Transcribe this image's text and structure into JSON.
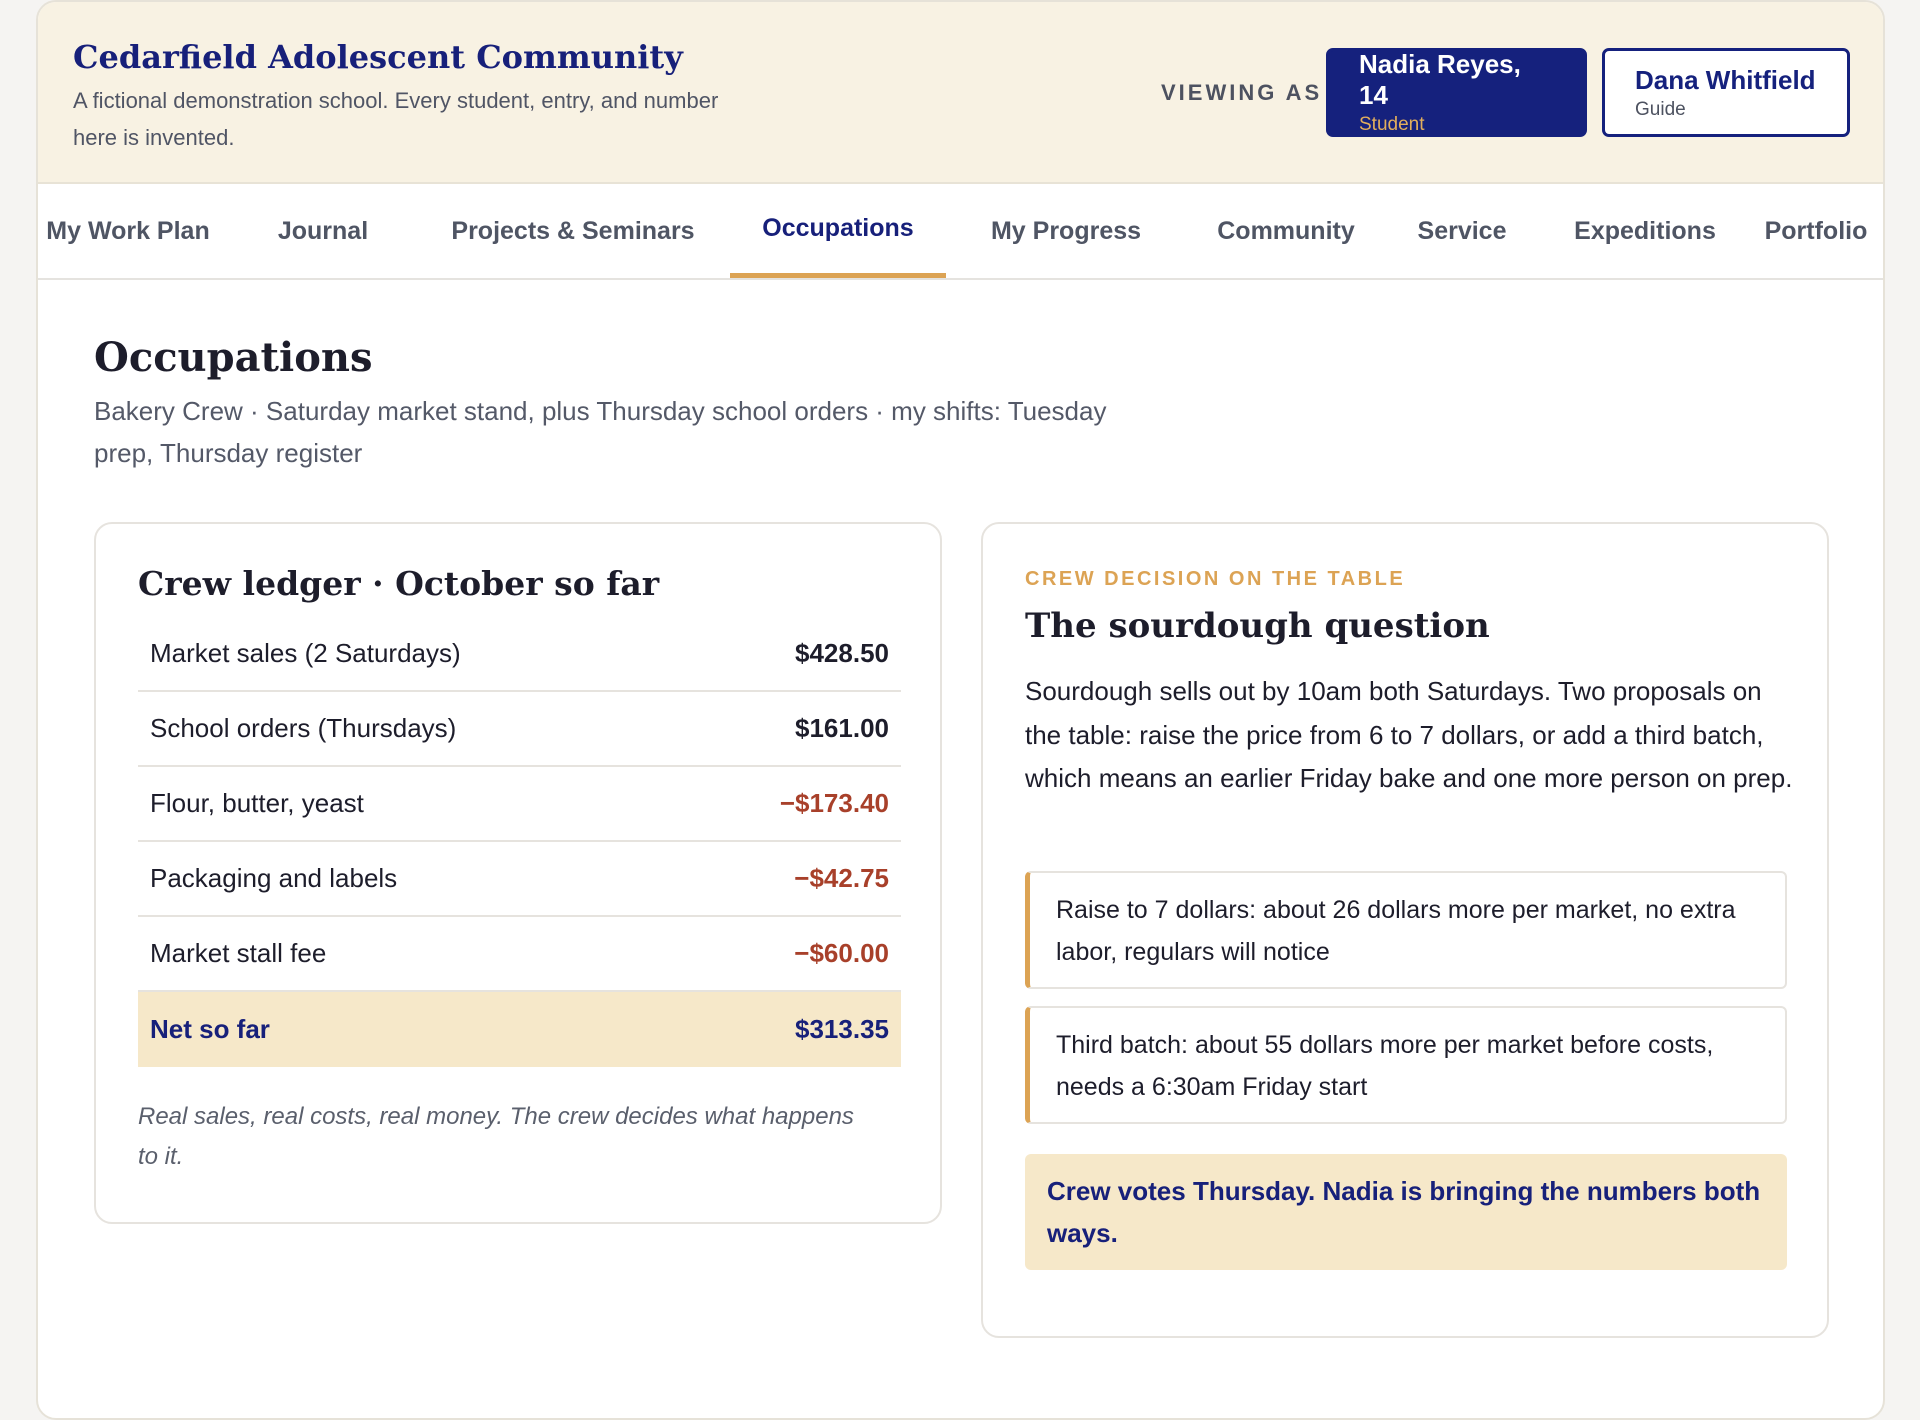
{
  "header": {
    "school_name": "Cedarfield Adolescent Community",
    "school_note": "A fictional demonstration school. Every student, entry, and number here is invented.",
    "viewing_as_label": "VIEWING AS",
    "users": [
      {
        "name": "Nadia Reyes, 14",
        "role": "Student",
        "active": true
      },
      {
        "name": "Dana Whitfield",
        "role": "Guide",
        "active": false
      }
    ]
  },
  "nav": {
    "tabs": [
      {
        "label": "My Work Plan"
      },
      {
        "label": "Journal"
      },
      {
        "label": "Projects & Seminars"
      },
      {
        "label": "Occupations",
        "active": true
      },
      {
        "label": "My Progress"
      },
      {
        "label": "Community"
      },
      {
        "label": "Service"
      },
      {
        "label": "Expeditions"
      },
      {
        "label": "Portfolio"
      }
    ]
  },
  "page": {
    "title": "Occupations",
    "subtitle": "Bakery Crew · Saturday market stand, plus Thursday school orders · my shifts: Tuesday prep, Thursday register"
  },
  "ledger": {
    "title": "Crew ledger · October so far",
    "rows": [
      {
        "label": "Market sales (2 Saturdays)",
        "amount": "$428.50"
      },
      {
        "label": "School orders (Thursdays)",
        "amount": "$161.00"
      },
      {
        "label": "Flour, butter, yeast",
        "amount": "−$173.40"
      },
      {
        "label": "Packaging and labels",
        "amount": "−$42.75"
      },
      {
        "label": "Market stall fee",
        "amount": "−$60.00"
      }
    ],
    "total": {
      "label": "Net so far",
      "amount": "$313.35"
    },
    "note": "Real sales, real costs, real money. The crew decides what happens to it.",
    "colors": {
      "negative": "#a8402a",
      "total_bg": "#f6e8c9"
    }
  },
  "decision": {
    "kicker": "CREW DECISION ON THE TABLE",
    "title": "The sourdough question",
    "body": "Sourdough sells out by 10am both Saturdays. Two proposals on the table: raise the price from 6 to 7 dollars, or add a third batch, which means an earlier Friday bake and one more person on prep.",
    "options": [
      {
        "text": "Raise to 7 dollars: about 26 dollars more per market, no extra labor, regulars will notice"
      },
      {
        "text": "Third batch: about 55 dollars more per market before costs, needs a 6:30am Friday start"
      }
    ],
    "vote_note": "Crew votes Thursday. Nadia is bringing the numbers both ways."
  },
  "colors": {
    "brand_navy": "#15217d",
    "accent_gold": "#dca354",
    "header_bg": "#f8f2e3"
  }
}
